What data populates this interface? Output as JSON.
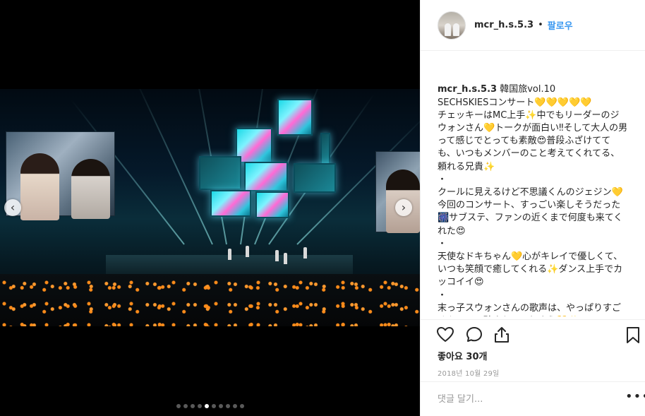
{
  "post": {
    "username": "mcr_h.s.5.3",
    "follow_label": "팔로우",
    "bullet": "•",
    "caption_user": "mcr_h.s.5.3",
    "caption_text": " 韓国旅vol.10\nSECHSKIESコンサート💛💛💛💛💛\nチェッキーはMC上手✨中でもリーダーのジウォンさん💛トークが面白い‼︎そして大人の男って感じでとっても素敵😍普段ふざけてても、いつもメンバーのこと考えてくれてる、頼れる兄貴✨\n・\nクールに見えるけど不思議くんのジェジン💛今回のコンサート、すっごい楽しそうだった🎆サブステ、ファンの近くまで何度も来てくれた😍\n・\n天使なドキちゃん💛心がキレイで優しくて、いつも笑顔で癒してくれる✨ダンス上手でカッコイイ😍\n・\n末っ子スウォンさんの歌声は、やっぱりすごくキレイで聴き入ってしまう💛✨ソロステージのバラード、すっごく良かった～😍",
    "likes": "좋아요 30개",
    "date": "2018년 10월 29일",
    "comment_placeholder": "댓글 달기...",
    "more_label": "•••"
  },
  "carousel": {
    "prev_label": "‹",
    "next_label": "›",
    "dot_count": 10,
    "active_dot": 4
  },
  "icons": {
    "like": "heart-outline-icon",
    "comment": "speech-bubble-icon",
    "share": "share-icon",
    "save": "bookmark-icon"
  },
  "colors": {
    "link": "#3897f0",
    "text": "#262626",
    "muted": "#999999",
    "border": "#efefef",
    "glowstick": "#ff8c1a",
    "stage_cyan": "#1cd9e6"
  }
}
